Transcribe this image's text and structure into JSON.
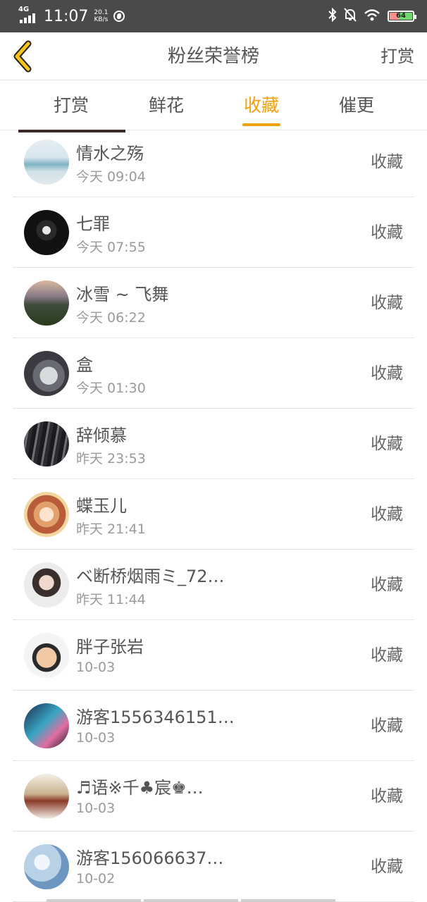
{
  "status_bar": {
    "network": "4G",
    "time": "11:07",
    "speed_value": "20.1",
    "speed_unit": "KB/s",
    "battery": "64"
  },
  "header": {
    "title": "粉丝荣誉榜",
    "right_link": "打赏"
  },
  "tabs": [
    {
      "label": "打赏",
      "active": false
    },
    {
      "label": "鲜花",
      "active": false
    },
    {
      "label": "收藏",
      "active": true
    },
    {
      "label": "催更",
      "active": false
    }
  ],
  "list": [
    {
      "name": "情水之殇",
      "time": "今天 09:04",
      "action": "收藏"
    },
    {
      "name": "七罪",
      "time": "今天 07:55",
      "action": "收藏"
    },
    {
      "name": "冰雪 ~ 飞舞",
      "time": "今天 06:22",
      "action": "收藏"
    },
    {
      "name": "盒",
      "time": "今天 01:30",
      "action": "收藏"
    },
    {
      "name": "辞倾慕",
      "time": "昨天 23:53",
      "action": "收藏"
    },
    {
      "name": "蝶玉儿",
      "time": "昨天 21:41",
      "action": "收藏"
    },
    {
      "name": "ベ断桥烟雨ミ_72…",
      "time": "昨天 11:44",
      "action": "收藏"
    },
    {
      "name": "胖子张岩",
      "time": "10-03",
      "action": "收藏"
    },
    {
      "name": "游客1556346151…",
      "time": "10-03",
      "action": "收藏"
    },
    {
      "name": "♬语※千♣宸♚…",
      "time": "10-03",
      "action": "收藏"
    },
    {
      "name": "游客156066637…",
      "time": "10-02",
      "action": "收藏"
    }
  ],
  "colors": {
    "accent": "#f0a10c",
    "status_bar": "#4a4a4a"
  }
}
